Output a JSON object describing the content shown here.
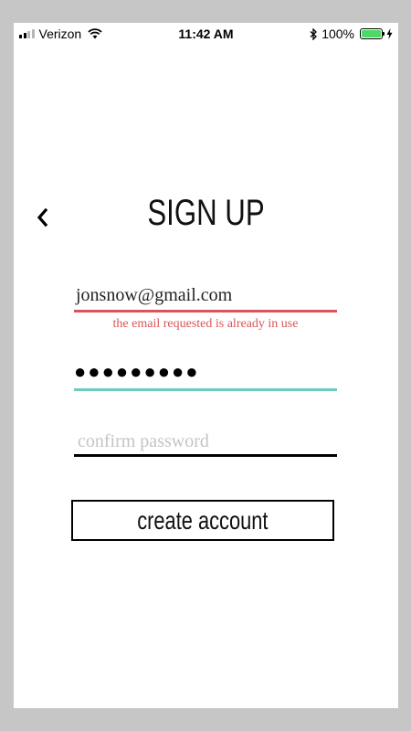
{
  "status_bar": {
    "carrier": "Verizon",
    "time": "11:42 AM",
    "battery_percent": "100%",
    "battery_color": "#4cd964"
  },
  "header": {
    "title": "SIGN UP",
    "back_icon": "chevron-left-icon"
  },
  "form": {
    "email_value": "jonsnow@gmail.com",
    "email_error": "the email requested is already in use",
    "password_masked": "●●●●●●●●●",
    "confirm_placeholder": "confirm password",
    "submit_label": "create account"
  },
  "colors": {
    "error": "#d9555b",
    "active": "#6ccdbd",
    "default_line": "#000000"
  }
}
